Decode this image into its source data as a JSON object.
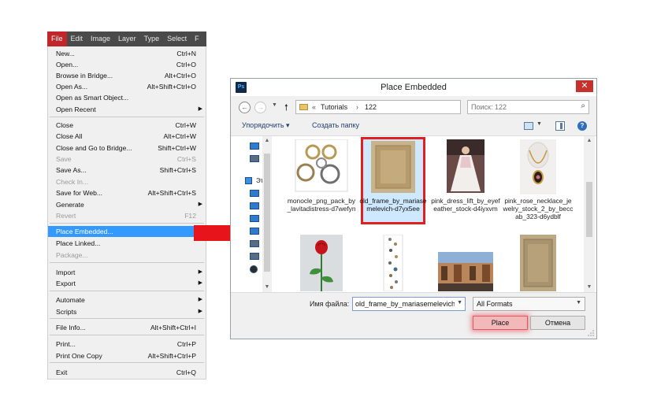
{
  "menubar": {
    "items": [
      "File",
      "Edit",
      "Image",
      "Layer",
      "Type",
      "Select",
      "F"
    ]
  },
  "file_menu": {
    "items": [
      {
        "label": "New...",
        "shortcut": "Ctrl+N"
      },
      {
        "label": "Open...",
        "shortcut": "Ctrl+O"
      },
      {
        "label": "Browse in Bridge...",
        "shortcut": "Alt+Ctrl+O"
      },
      {
        "label": "Open As...",
        "shortcut": "Alt+Shift+Ctrl+O"
      },
      {
        "label": "Open as Smart Object...",
        "shortcut": ""
      },
      {
        "label": "Open Recent",
        "shortcut": ""
      },
      {
        "label": "Close",
        "shortcut": "Ctrl+W"
      },
      {
        "label": "Close All",
        "shortcut": "Alt+Ctrl+W"
      },
      {
        "label": "Close and Go to Bridge...",
        "shortcut": "Shift+Ctrl+W"
      },
      {
        "label": "Save",
        "shortcut": "Ctrl+S"
      },
      {
        "label": "Save As...",
        "shortcut": "Shift+Ctrl+S"
      },
      {
        "label": "Check In...",
        "shortcut": ""
      },
      {
        "label": "Save for Web...",
        "shortcut": "Alt+Shift+Ctrl+S"
      },
      {
        "label": "Generate",
        "shortcut": ""
      },
      {
        "label": "Revert",
        "shortcut": "F12"
      },
      {
        "label": "Place Embedded...",
        "shortcut": ""
      },
      {
        "label": "Place Linked...",
        "shortcut": ""
      },
      {
        "label": "Package...",
        "shortcut": ""
      },
      {
        "label": "Import",
        "shortcut": ""
      },
      {
        "label": "Export",
        "shortcut": ""
      },
      {
        "label": "Automate",
        "shortcut": ""
      },
      {
        "label": "Scripts",
        "shortcut": ""
      },
      {
        "label": "File Info...",
        "shortcut": "Alt+Shift+Ctrl+I"
      },
      {
        "label": "Print...",
        "shortcut": "Ctrl+P"
      },
      {
        "label": "Print One Copy",
        "shortcut": "Alt+Shift+Ctrl+P"
      },
      {
        "label": "Exit",
        "shortcut": "Ctrl+Q"
      }
    ]
  },
  "dialog": {
    "title": "Place Embedded",
    "app_icon": "Ps",
    "close_glyph": "✕",
    "path": [
      "Tutorials",
      "122"
    ],
    "path_prefix": "«",
    "search_placeholder": "Поиск: 122",
    "organize_label": "Упорядочить ▾",
    "new_folder_label": "Создать папку",
    "nav_labels": [
      "Эт"
    ],
    "files": [
      {
        "name": "monocle_png_pack_by_lavitadistress-d7wefyn"
      },
      {
        "name": "old_frame_by_mariasemelevich-d7yx5ee"
      },
      {
        "name": "pink_dress_lift_by_eyefeather_stock-d4iyxvm"
      },
      {
        "name": "pink_rose_necklace_jewelry_stock_2_by_beccab_323-d6ydblf"
      },
      {
        "name": ""
      },
      {
        "name": ""
      },
      {
        "name": ""
      },
      {
        "name": ""
      }
    ],
    "selected_file_index": 1,
    "filename_label": "Имя файла:",
    "filename_value": "old_frame_by_mariasemelevich-",
    "filter_value": "All Formats",
    "place_label": "Place",
    "cancel_label": "Отмена"
  },
  "colors": {
    "menu_highlight": "#3399ff",
    "file_menu_active": "#c0262a",
    "selection_outline": "#e02020",
    "arrow": "#e8141b",
    "dialog_close": "#c7312c"
  }
}
